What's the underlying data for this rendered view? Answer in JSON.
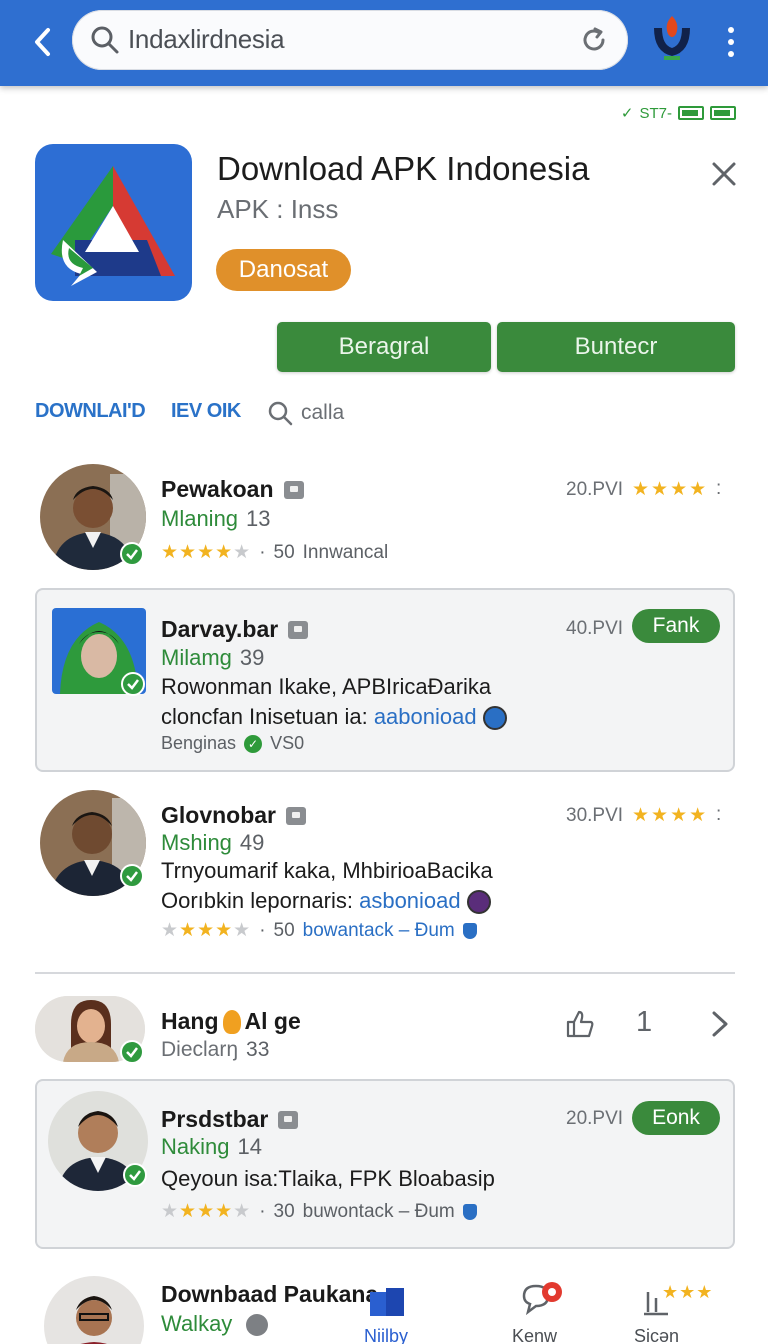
{
  "search": {
    "query": "Indaxlirdnesia"
  },
  "status_bar": {
    "signal_text": "ST7-"
  },
  "app": {
    "title": "Download APK Indonesia",
    "subtitle": "APK : Inss",
    "download_pill": "Danosat",
    "buttons": [
      "Beragral",
      "Buntecr"
    ]
  },
  "links": {
    "download": "DOWNLAI'D",
    "review": "IEV OIK",
    "search_label": "calla"
  },
  "items": [
    {
      "name": "Pewakoan",
      "sub_label": "Mlaning",
      "sub_num": "13",
      "meta_count": "50",
      "meta_text": "Innwancal",
      "time": "20.PVI",
      "rating": 4.5
    },
    {
      "name": "Darvay.bar",
      "sub_label": "Milamg",
      "sub_num": "39",
      "desc1": "Rowonman Ikake, APBIricaĐarika",
      "desc2_prefix": "cloncfan Inisetuan ia: ",
      "desc2_link": "aabonioad",
      "footer_text": "Benginas",
      "footer_badge": "VS0",
      "time": "40.PVI",
      "action": "Fank"
    },
    {
      "name": "Glovnobar",
      "sub_label": "Mshing",
      "sub_num": "49",
      "desc1": "Trnyoumarif kaka, MhbirioaBacika",
      "desc2_prefix": "Oorıbkin lepornaris: ",
      "desc2_link": "asbonioad",
      "meta_count": "50",
      "meta_link": "bowantack – Ðum",
      "time": "30.PVI",
      "rating": 4
    },
    {
      "name_a": "Hang",
      "name_b": "Al ge",
      "sub_label": "Dieclarŋ",
      "sub_num": "33",
      "count": "1"
    },
    {
      "name": "Prsdstbar",
      "sub_label": "Naking",
      "sub_num": "14",
      "desc1": "Qeyoun isa:Tlaika, FPK Bloabasip",
      "meta_count": "30",
      "meta_link": "buwontack – Ðum",
      "time": "20.PVI",
      "action": "Eonk",
      "rating": 4
    },
    {
      "name": "Downbaad Paukana",
      "sub_label": "Walkay"
    }
  ],
  "bottom_nav": {
    "labels": [
      "Niilby",
      "Kenw",
      "Sicən"
    ]
  },
  "colors": {
    "topbar": "#2f6fd0",
    "accent_green": "#3a8a3c",
    "accent_orange": "#e0902a",
    "link_blue": "#2a72c8",
    "star": "#f2b320"
  }
}
